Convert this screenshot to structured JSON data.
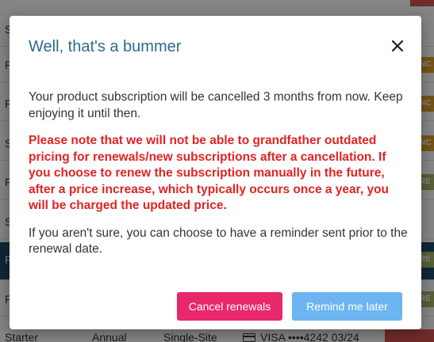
{
  "background": {
    "row_letters": [
      "S",
      "P",
      "P",
      "S",
      "P",
      "S",
      "P",
      "P"
    ],
    "badges": [
      {
        "text": "NC",
        "color": "#e0a030"
      },
      {
        "text": "NC",
        "color": "#e0a030"
      },
      {
        "text": "NC",
        "color": "#e0a030"
      },
      {
        "text": "RE",
        "color": "#a9b86a"
      },
      {
        "text": "RE",
        "color": "#a9b86a"
      },
      {
        "text": "RE",
        "color": "#a9b86a"
      }
    ],
    "bottom_row": {
      "plan": "Starter",
      "billing": "Annual",
      "site": "Single-Site",
      "card": "VISA ••••4242 03/24"
    }
  },
  "modal": {
    "title": "Well, that's a bummer",
    "paragraph1": "Your product subscription will be cancelled 3 months from now. Keep enjoying it until then.",
    "warning": "Please note that we will not be able to grandfather outdated pricing for renewals/new subscriptions after a cancellation. If you choose to renew the subscription manually in the future, after a price increase, which typically occurs once a year, you will be charged the updated price.",
    "paragraph2": "If you aren't sure, you can choose to have a reminder sent prior to the renewal date.",
    "cancel_label": "Cancel renewals",
    "remind_label": "Remind me later",
    "close_icon": "close-icon"
  },
  "colors": {
    "title": "#2c6a8f",
    "warning": "#e02424",
    "cancel_button": "#e8286b",
    "remind_button": "#6cb5f0"
  }
}
